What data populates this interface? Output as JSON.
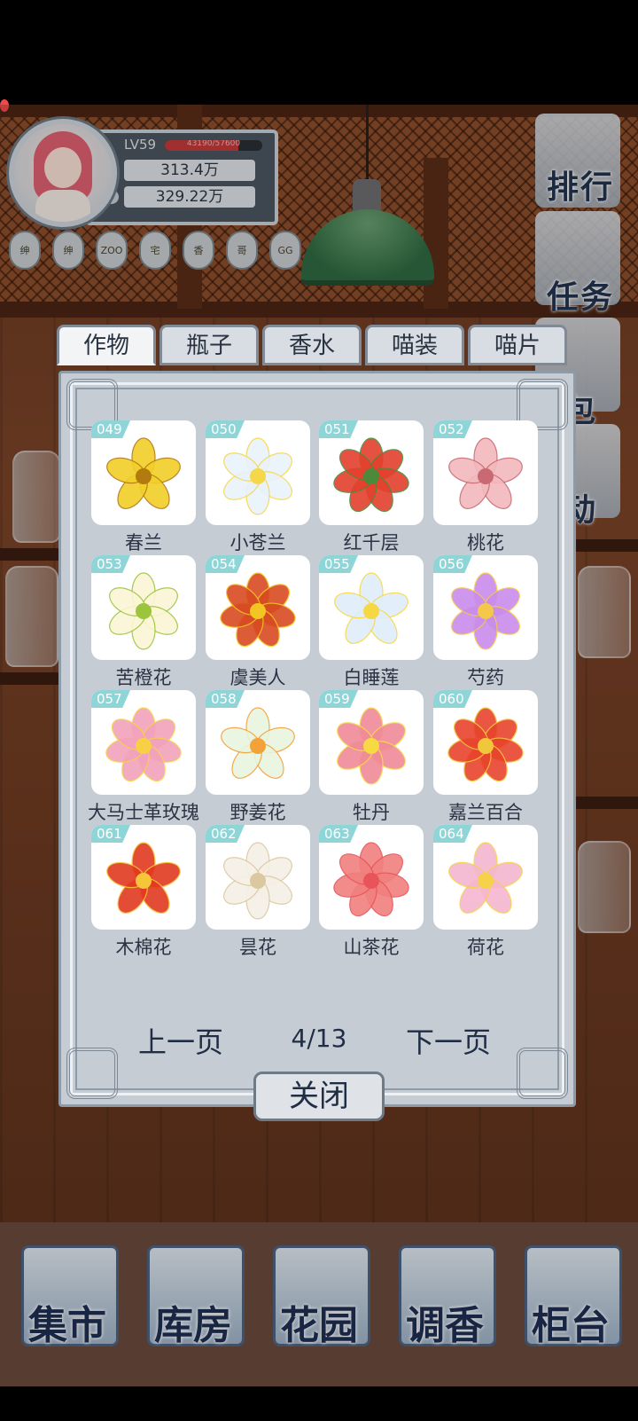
{
  "player": {
    "level": "LV59",
    "xp_text": "43190/57600",
    "xp_fraction": 0.75,
    "currency_1": "313.4万",
    "currency_2": "329.22万",
    "badges": [
      "绅",
      "绅",
      "ZOO",
      "宅",
      "香",
      "哥",
      "GG"
    ]
  },
  "side_buttons": [
    "排行",
    "任务",
    "包",
    "动"
  ],
  "nav": [
    "集市",
    "库房",
    "花园",
    "调香",
    "柜台"
  ],
  "tabs": [
    "作物",
    "瓶子",
    "香水",
    "喵装",
    "喵片"
  ],
  "active_tab": 0,
  "items": [
    {
      "num": "049",
      "name": "春兰",
      "color": "#f2cf28",
      "accent": "#b37a10"
    },
    {
      "num": "050",
      "name": "小苍兰",
      "color": "#e9f2fb",
      "accent": "#f5d84a"
    },
    {
      "num": "051",
      "name": "红千层",
      "color": "#e4402d",
      "accent": "#4a8a3a"
    },
    {
      "num": "052",
      "name": "桃花",
      "color": "#f2b9bd",
      "accent": "#c96a73"
    },
    {
      "num": "053",
      "name": "苦橙花",
      "color": "#fbf6d6",
      "accent": "#9cc43c"
    },
    {
      "num": "054",
      "name": "虞美人",
      "color": "#d84b22",
      "accent": "#f2c522"
    },
    {
      "num": "055",
      "name": "白睡莲",
      "color": "#dfeefa",
      "accent": "#f6d845"
    },
    {
      "num": "056",
      "name": "芍药",
      "color": "#c98cec",
      "accent": "#f4c84a"
    },
    {
      "num": "057",
      "name": "大马士革玫瑰",
      "color": "#f2a2bc",
      "accent": "#f7d046"
    },
    {
      "num": "058",
      "name": "野姜花",
      "color": "#e8f5df",
      "accent": "#f3a23a"
    },
    {
      "num": "059",
      "name": "牡丹",
      "color": "#f08a98",
      "accent": "#f6da44"
    },
    {
      "num": "060",
      "name": "嘉兰百合",
      "color": "#e8442e",
      "accent": "#f0c63a"
    },
    {
      "num": "061",
      "name": "木棉花",
      "color": "#e23a20",
      "accent": "#f6c53a"
    },
    {
      "num": "062",
      "name": "昙花",
      "color": "#f6f0e6",
      "accent": "#d9c8a0"
    },
    {
      "num": "063",
      "name": "山茶花",
      "color": "#f0807e",
      "accent": "#e9535a"
    },
    {
      "num": "064",
      "name": "荷花",
      "color": "#f5b6d0",
      "accent": "#f6d24a"
    }
  ],
  "pager": {
    "prev": "上一页",
    "next": "下一页",
    "page": "4/13"
  },
  "close_label": "关闭"
}
